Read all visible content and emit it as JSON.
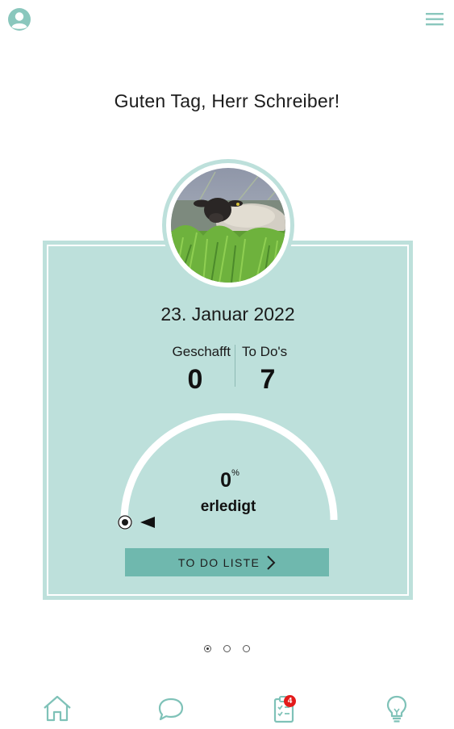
{
  "header": {
    "profile_icon": "user-circle-icon",
    "menu_icon": "hamburger-menu-icon"
  },
  "greeting": "Guten Tag, Herr Schreiber!",
  "card": {
    "avatar_image": "sheep-photo",
    "date": "23. Januar 2022",
    "stats": {
      "done_label": "Geschafft",
      "done_value": "0",
      "todo_label": "To Do's",
      "todo_value": "7"
    },
    "progress": {
      "percent_value": "0",
      "percent_sign": "%",
      "fraction": 0,
      "label": "erledigt"
    },
    "button_label": "TO DO LISTE"
  },
  "pagination": {
    "count": 3,
    "active_index": 0
  },
  "bottom_nav": {
    "items": [
      "home-icon",
      "chat-icon",
      "tasks-clipboard-icon",
      "lightbulb-icon"
    ],
    "tasks_badge": "4"
  },
  "colors": {
    "accent_light": "#bde0db",
    "accent": "#6fb8ae",
    "icon": "#7fc2b8",
    "badge": "#e31b1b"
  }
}
